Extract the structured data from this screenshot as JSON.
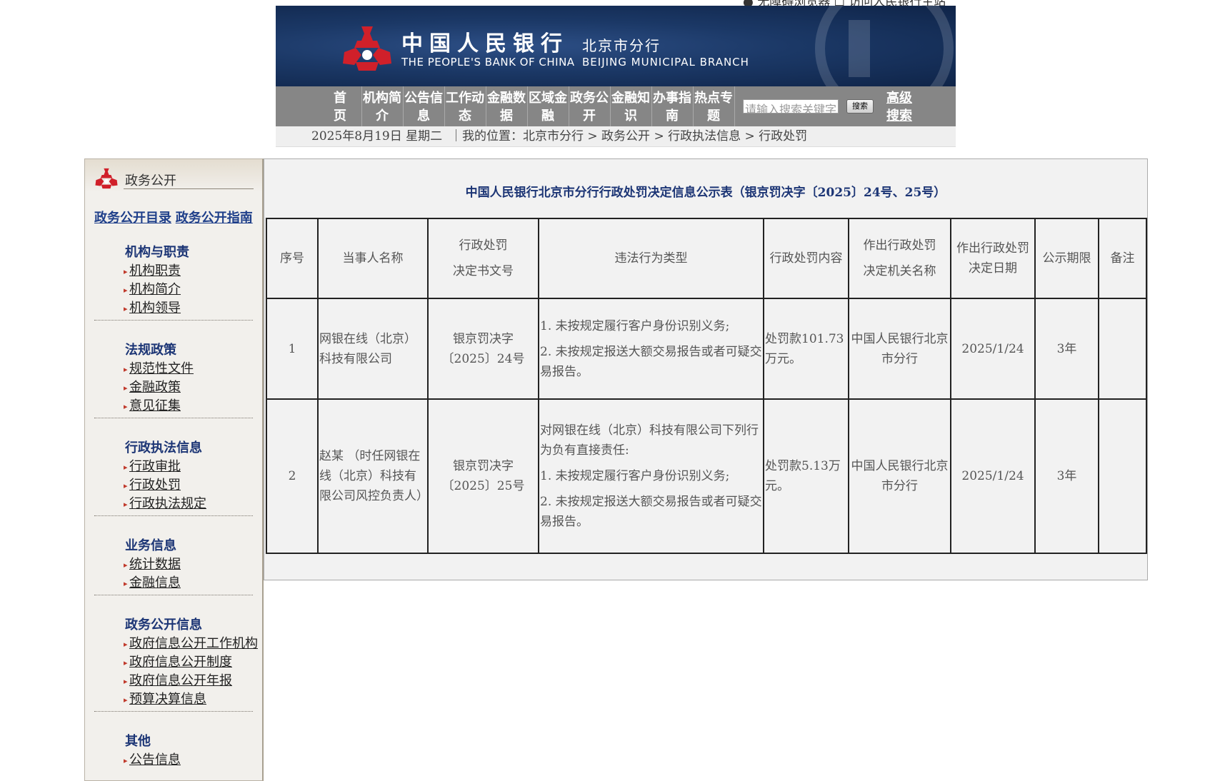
{
  "top_cut_text": "● 无障碍浏览器  ☐ 访问人民银行主站",
  "header": {
    "cn_name": "中国人民银行",
    "cn_branch": "北京市分行",
    "en_name": "THE PEOPLE'S BANK OF CHINA",
    "en_branch": "BEIJING MUNICIPAL  BRANCH"
  },
  "nav": {
    "items": [
      {
        "l1": "首",
        "l2": "页"
      },
      {
        "l1": "机构简",
        "l2": "介"
      },
      {
        "l1": "公告信",
        "l2": "息"
      },
      {
        "l1": "工作动",
        "l2": "态"
      },
      {
        "l1": "金融数",
        "l2": "据"
      },
      {
        "l1": "区域金",
        "l2": "融"
      },
      {
        "l1": "政务公",
        "l2": "开"
      },
      {
        "l1": "金融知",
        "l2": "识"
      },
      {
        "l1": "办事指",
        "l2": "南"
      },
      {
        "l1": "热点专",
        "l2": "题"
      }
    ],
    "search_placeholder": "请输入搜索关键字",
    "search_button": "搜索",
    "adv_l1": "高级",
    "adv_l2": "搜索"
  },
  "breadcrumb": {
    "date": "2025年8月19日 星期二",
    "location": "｜我的位置：北京市分行 > 政务公开 > 行政执法信息 > 行政处罚"
  },
  "sidebar": {
    "title": "政务公开",
    "link1": "政务公开目录",
    "link2": "政务公开指南",
    "groups": [
      {
        "title": "机构与职责",
        "items": [
          "机构职责",
          "机构简介",
          "机构领导"
        ]
      },
      {
        "title": "法规政策",
        "items": [
          "规范性文件",
          "金融政策",
          "意见征集"
        ]
      },
      {
        "title": "行政执法信息",
        "items": [
          "行政审批",
          "行政处罚",
          "行政执法规定"
        ]
      },
      {
        "title": "业务信息",
        "items": [
          "统计数据",
          "金融信息"
        ]
      },
      {
        "title": "政务公开信息",
        "items": [
          "政府信息公开工作机构",
          "政府信息公开制度",
          "政府信息公开年报",
          "预算决算信息"
        ]
      },
      {
        "title": "其他",
        "items": [
          "公告信息"
        ]
      }
    ]
  },
  "main": {
    "title": "中国人民银行北京市分行行政处罚决定信息公示表（银京罚决字〔2025〕24号、25号）",
    "headers": {
      "seq": "序号",
      "party": "当事人名称",
      "doc_l1": "行政处罚",
      "doc_l2": "决定书文号",
      "violation": "违法行为类型",
      "content": "行政处罚内容",
      "org_l1": "作出行政处罚",
      "org_l2": "决定机关名称",
      "date_l1": "作出行政处罚",
      "date_l2": "决定日期",
      "period": "公示期限",
      "remark": "备注"
    },
    "rows": [
      {
        "seq": "1",
        "party": "网银在线（北京）科技有限公司",
        "doc": "银京罚决字〔2025〕24号",
        "violation_pre": "",
        "violation_1": "1. 未按规定履行客户身份识别义务;",
        "violation_2": "2. 未按规定报送大额交易报告或者可疑交易报告。",
        "content": "处罚款101.73万元。",
        "org": "中国人民银行北京市分行",
        "date": "2025/1/24",
        "period": "3年",
        "remark": ""
      },
      {
        "seq": "2",
        "party": "赵某 （时任网银在线（北京）科技有限公司风控负责人）",
        "doc": "银京罚决字〔2025〕25号",
        "violation_pre": "对网银在线（北京）科技有限公司下列行为负有直接责任:",
        "violation_1": "1. 未按规定履行客户身份识别义务;",
        "violation_2": "2. 未按规定报送大额交易报告或者可疑交易报告。",
        "content": "处罚款5.13万元。",
        "org": "中国人民银行北京市分行",
        "date": "2025/1/24",
        "period": "3年",
        "remark": ""
      }
    ]
  },
  "colors": {
    "banner_dark": "#0f2448",
    "nav_gray": "#868686",
    "link_blue": "#1f3f8a",
    "group_blue": "#1c3575",
    "bullet_red": "#c0392b",
    "logo_red": "#d0202a"
  }
}
